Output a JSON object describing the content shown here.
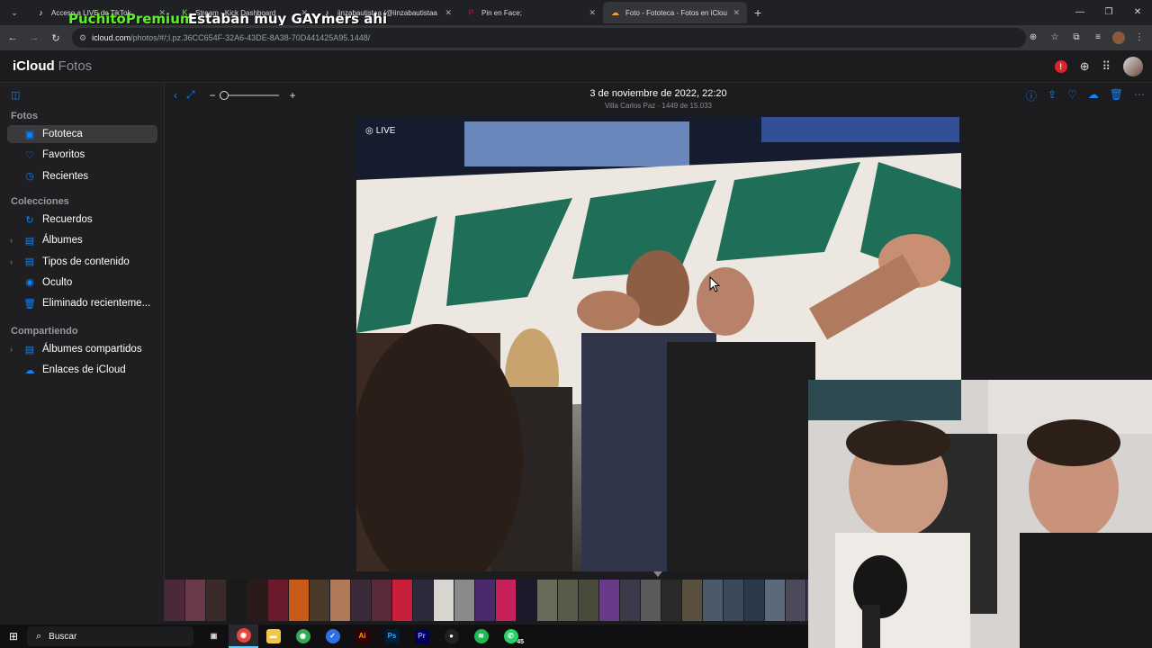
{
  "browser": {
    "tabs": [
      {
        "title": "Acceso a LIVE de TikTok",
        "icon": "tiktok-icon",
        "favicon": "♪",
        "fav_color": "#ffffff",
        "active": false
      },
      {
        "title": "Stream - Kick Dashboard",
        "icon": "kick-icon",
        "favicon": "K",
        "fav_color": "#53fc18",
        "active": false
      },
      {
        "title": "iinzabautistaa (@iinzabautistaa",
        "icon": "tiktok-icon",
        "favicon": "♪",
        "fav_color": "#ffffff",
        "active": false
      },
      {
        "title": "Pin en Face;",
        "icon": "pinterest-icon",
        "favicon": "P",
        "fav_color": "#e60023",
        "active": false
      },
      {
        "title": "Foto - Fototeca - Fotos en iClou",
        "icon": "icloud-icon",
        "favicon": "☁",
        "fav_color": "#f5a623",
        "active": true
      }
    ],
    "address": {
      "host": "icloud.com",
      "path": "/photos/#/;l.pz.36CC654F-32A6-43DE-8A38-70D441425A95.1448/"
    }
  },
  "overlay": {
    "line1": "PuchitoPremium",
    "line2": "Estaban muy GAYmers ahi"
  },
  "app": {
    "name": "iCloud",
    "section": "Fotos",
    "alert_badge": "!"
  },
  "sidebar": {
    "sections": [
      {
        "label": "Fotos",
        "items": [
          {
            "label": "Fototeca",
            "icon": "photo-library-icon",
            "glyph": "▣",
            "selected": true,
            "expandable": false
          },
          {
            "label": "Favoritos",
            "icon": "heart-icon",
            "glyph": "♡",
            "selected": false,
            "expandable": false
          },
          {
            "label": "Recientes",
            "icon": "clock-icon",
            "glyph": "◷",
            "selected": false,
            "expandable": false
          }
        ]
      },
      {
        "label": "Colecciones",
        "items": [
          {
            "label": "Recuerdos",
            "icon": "memories-icon",
            "glyph": "↻",
            "selected": false,
            "expandable": false
          },
          {
            "label": "Álbumes",
            "icon": "albums-icon",
            "glyph": "▤",
            "selected": false,
            "expandable": true
          },
          {
            "label": "Tipos de contenido",
            "icon": "media-types-icon",
            "glyph": "▤",
            "selected": false,
            "expandable": true
          },
          {
            "label": "Oculto",
            "icon": "eye-icon",
            "glyph": "◉",
            "selected": false,
            "expandable": false
          },
          {
            "label": "Eliminado recienteme...",
            "icon": "trash-icon",
            "glyph": "🗑",
            "selected": false,
            "expandable": false
          }
        ]
      },
      {
        "label": "Compartiendo",
        "items": [
          {
            "label": "Álbumes compartidos",
            "icon": "shared-albums-icon",
            "glyph": "▤",
            "selected": false,
            "expandable": true
          },
          {
            "label": "Enlaces de iCloud",
            "icon": "icloud-link-icon",
            "glyph": "☁",
            "selected": false,
            "expandable": false
          }
        ]
      }
    ]
  },
  "viewer": {
    "date": "3 de noviembre de 2022, 22:20",
    "location": "Villa Carlos Paz · 1449 de 15.033",
    "live_label": "LIVE",
    "zoom_minus": "−",
    "zoom_plus": "+",
    "zoom_level": 0
  },
  "taskbar": {
    "search_label": "Buscar",
    "whatsapp_badge": "45"
  }
}
